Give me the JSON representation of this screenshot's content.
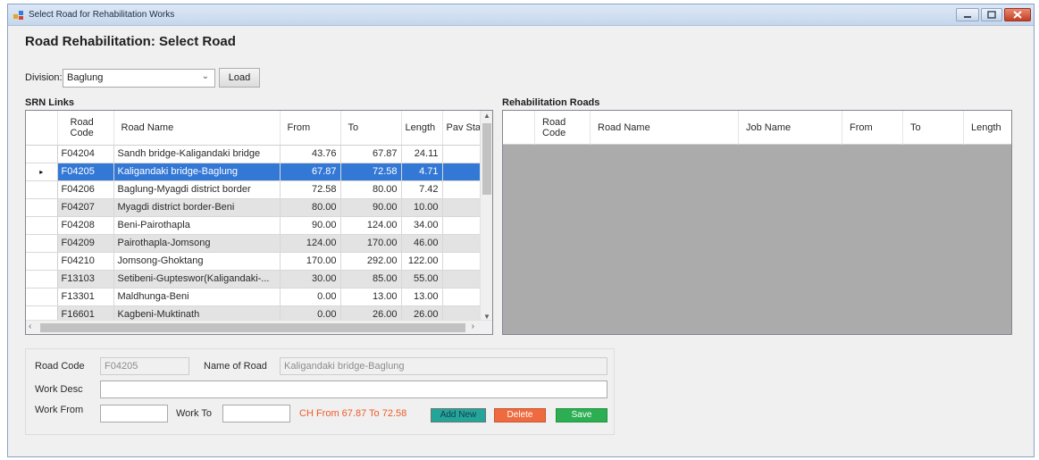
{
  "window": {
    "title": "Select Road for Rehabilitation Works"
  },
  "heading": "Road Rehabilitation: Select Road",
  "division": {
    "label": "Division:",
    "value": "Baglung",
    "load_label": "Load"
  },
  "srn": {
    "label": "SRN Links",
    "columns": [
      "Road Code",
      "Road Name",
      "From",
      "To",
      "Length",
      "Pav Sta"
    ],
    "rows": [
      {
        "code": "F04204",
        "name": "Sandh bridge-Kaligandaki bridge",
        "from": "43.76",
        "to": "67.87",
        "length": "24.11"
      },
      {
        "code": "F04205",
        "name": "Kaligandaki bridge-Baglung",
        "from": "67.87",
        "to": "72.58",
        "length": "4.71"
      },
      {
        "code": "F04206",
        "name": "Baglung-Myagdi district border",
        "from": "72.58",
        "to": "80.00",
        "length": "7.42"
      },
      {
        "code": "F04207",
        "name": "Myagdi district border-Beni",
        "from": "80.00",
        "to": "90.00",
        "length": "10.00"
      },
      {
        "code": "F04208",
        "name": "Beni-Pairothapla",
        "from": "90.00",
        "to": "124.00",
        "length": "34.00"
      },
      {
        "code": "F04209",
        "name": "Pairothapla-Jomsong",
        "from": "124.00",
        "to": "170.00",
        "length": "46.00"
      },
      {
        "code": "F04210",
        "name": "Jomsong-Ghoktang",
        "from": "170.00",
        "to": "292.00",
        "length": "122.00"
      },
      {
        "code": "F13103",
        "name": "Setibeni-Gupteswor(Kaligandaki-...",
        "from": "30.00",
        "to": "85.00",
        "length": "55.00"
      },
      {
        "code": "F13301",
        "name": "Maldhunga-Beni",
        "from": "0.00",
        "to": "13.00",
        "length": "13.00"
      },
      {
        "code": "F16601",
        "name": "Kagbeni-Muktinath",
        "from": "0.00",
        "to": "26.00",
        "length": "26.00"
      }
    ],
    "selected_row_marker": "▸"
  },
  "rehab": {
    "label": "Rehabilitation Roads",
    "columns": [
      "Road Code",
      "Road Name",
      "Job Name",
      "From",
      "To",
      "Length"
    ]
  },
  "detail": {
    "road_code_label": "Road Code",
    "road_code_value": "F04205",
    "name_label": "Name of Road",
    "name_value": "Kaligandaki bridge-Baglung",
    "work_desc_label": "Work Desc",
    "work_desc_value": "",
    "work_from_label": "Work From",
    "work_from_value": "",
    "work_to_label": "Work To",
    "work_to_value": "",
    "chainage_text": "CH From 67.87 To 72.58",
    "add_label": "Add New",
    "delete_label": "Delete",
    "save_label": "Save"
  },
  "colors": {
    "selected_row": "#3478d6",
    "chainage_text": "#f05a28",
    "add_button": "#22a69a",
    "delete_button": "#ef6b3f",
    "save_button": "#2cae53"
  }
}
